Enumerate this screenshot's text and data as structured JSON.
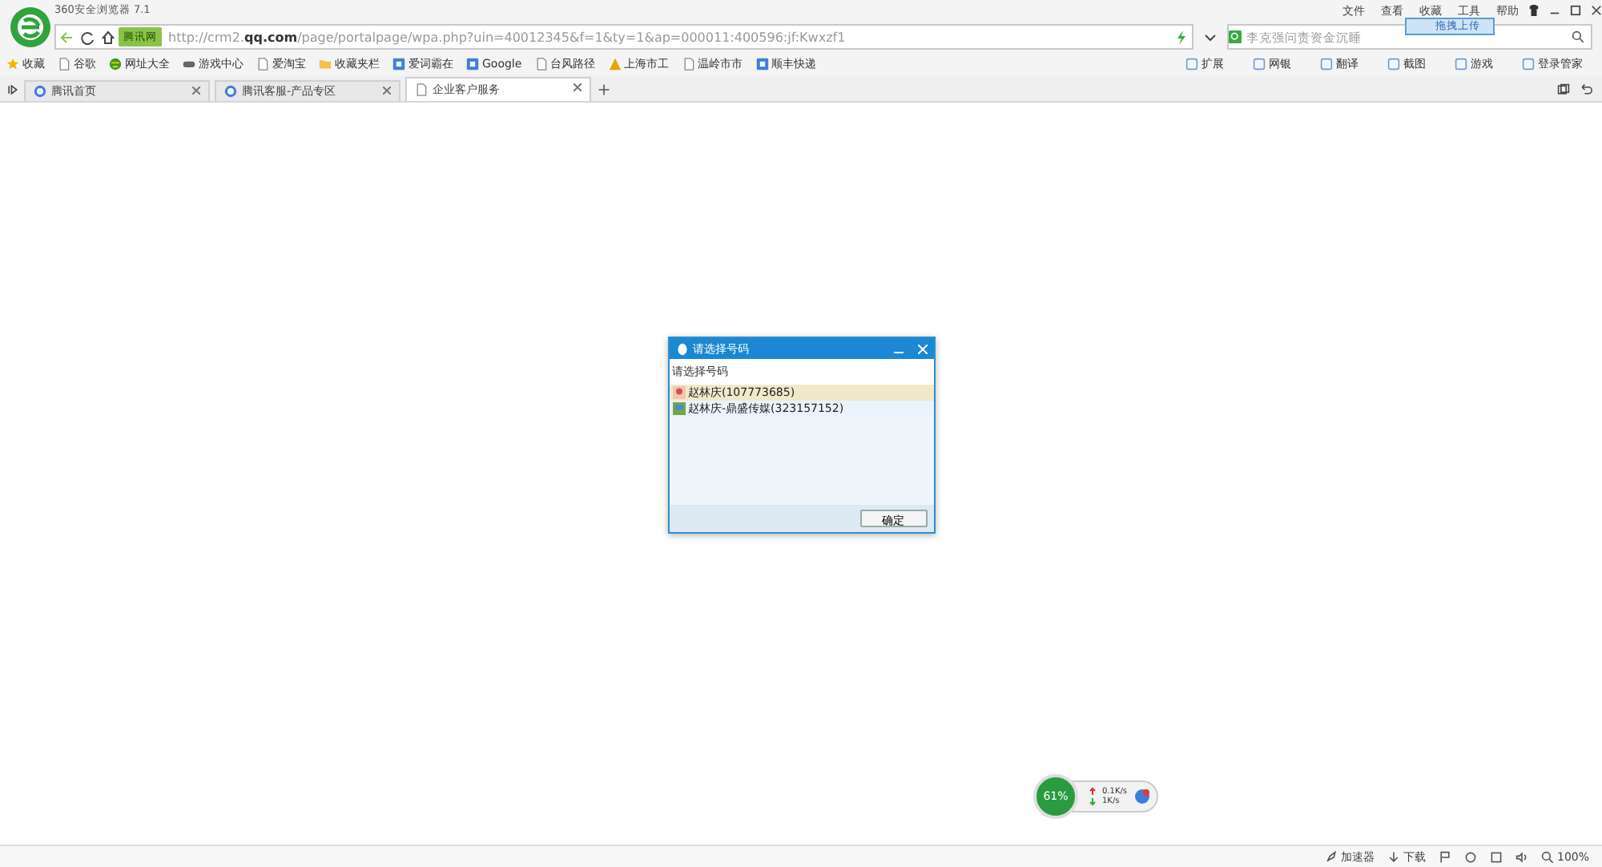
{
  "window": {
    "title": "360安全浏览器 7.1",
    "menu": [
      "文件",
      "查看",
      "收藏",
      "工具",
      "帮助"
    ]
  },
  "address": {
    "site_badge": "腾讯网",
    "url": "http://crm2.**qq.com**/page/portalpage/wpa.php?uin=40012345&f=1&ty=1&ap=000011:400596:jf:Kwxzf1"
  },
  "search": {
    "placeholder": "李克强问责资金沉睡",
    "upload_button": "拖拽上传"
  },
  "bookmarks": [
    {
      "label": "收藏",
      "kind": "star"
    },
    {
      "label": "谷歌",
      "kind": "page"
    },
    {
      "label": "网址大全",
      "kind": "globe"
    },
    {
      "label": "游戏中心",
      "kind": "game"
    },
    {
      "label": "爱淘宝",
      "kind": "page"
    },
    {
      "label": "收藏夹栏",
      "kind": "folder"
    },
    {
      "label": "爱词霸在",
      "kind": "site"
    },
    {
      "label": "Google",
      "kind": "site"
    },
    {
      "label": "台风路径",
      "kind": "page"
    },
    {
      "label": "上海市工",
      "kind": "warn"
    },
    {
      "label": "温岭市市",
      "kind": "page"
    },
    {
      "label": "顺丰快递",
      "kind": "site"
    }
  ],
  "tools": [
    "扩展",
    "网银",
    "翻译",
    "截图",
    "游戏",
    "登录管家"
  ],
  "tabs": [
    {
      "label": "腾讯首页",
      "selected": false
    },
    {
      "label": "腾讯客服-产品专区",
      "selected": false
    },
    {
      "label": "企业客户服务",
      "selected": true
    }
  ],
  "dialog": {
    "title": "请选择号码",
    "prompt": "请选择号码",
    "items": [
      {
        "label": "赵林庆(107773685)",
        "selected": true
      },
      {
        "label": "赵林庆-鼎盛传媒(323157152)",
        "selected": false
      }
    ],
    "ok": "确定"
  },
  "speed_widget": {
    "percent": "61%",
    "upload": "0.1K/s",
    "download": "1K/s"
  },
  "status_bar": {
    "accelerator": "加速器",
    "download": "下载",
    "zoom": "100%"
  }
}
